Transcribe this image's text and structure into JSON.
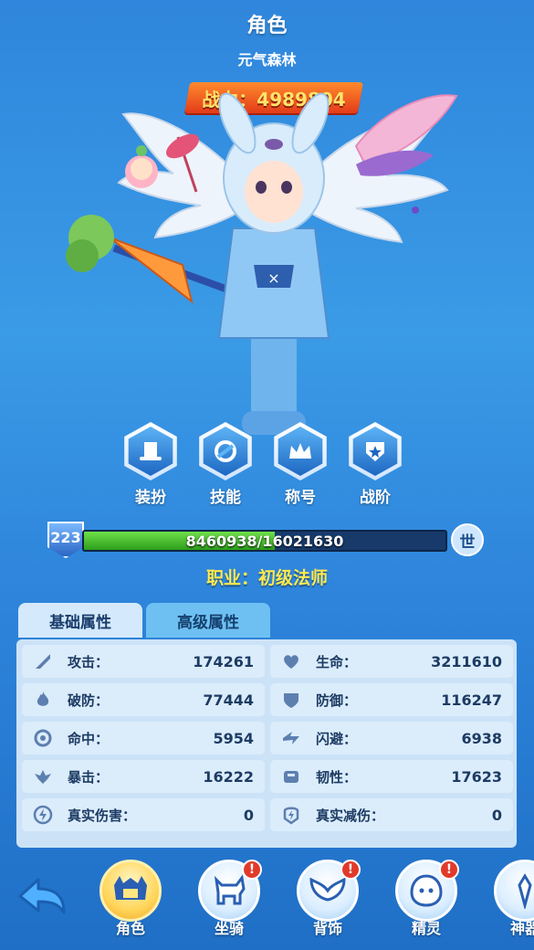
{
  "header": {
    "title": "角色",
    "subtitle": "元气森林",
    "power_label": "战力：4989804"
  },
  "actions": [
    {
      "label": "装扮",
      "icon": "top-hat-icon"
    },
    {
      "label": "技能",
      "icon": "skill-swirl-icon"
    },
    {
      "label": "称号",
      "icon": "crown-icon"
    },
    {
      "label": "战阶",
      "icon": "rank-shield-icon"
    }
  ],
  "level": {
    "value": "223",
    "xp_text": "8460938/16021630",
    "xp_fraction": 0.528,
    "world_button": "世"
  },
  "job": "职业：初级法师",
  "tabs": {
    "basic": "基础属性",
    "advanced": "高级属性"
  },
  "stats": [
    {
      "name": "攻击：",
      "value": "174261",
      "icon": "attack-icon"
    },
    {
      "name": "生命：",
      "value": "3211610",
      "icon": "heart-icon"
    },
    {
      "name": "破防：",
      "value": "77444",
      "icon": "flame-icon"
    },
    {
      "name": "防御：",
      "value": "116247",
      "icon": "shield-icon"
    },
    {
      "name": "命中：",
      "value": "5954",
      "icon": "target-icon"
    },
    {
      "name": "闪避：",
      "value": "6938",
      "icon": "dodge-icon"
    },
    {
      "name": "暴击：",
      "value": "16222",
      "icon": "crit-icon"
    },
    {
      "name": "韧性：",
      "value": "17623",
      "icon": "toughness-icon"
    },
    {
      "name": "真实伤害：",
      "value": "0",
      "icon": "true-damage-icon"
    },
    {
      "name": "真实减伤：",
      "value": "0",
      "icon": "true-reduction-icon"
    }
  ],
  "nav": [
    {
      "label": "角色",
      "icon": "character-helmet-icon",
      "active": true,
      "alert": false
    },
    {
      "label": "坐骑",
      "icon": "mount-icon",
      "active": false,
      "alert": true
    },
    {
      "label": "背饰",
      "icon": "wings-icon",
      "active": false,
      "alert": true
    },
    {
      "label": "精灵",
      "icon": "spirit-icon",
      "active": false,
      "alert": true
    },
    {
      "label": "神器",
      "icon": "artifact-icon",
      "active": false,
      "alert": false
    }
  ],
  "alert_mark": "!",
  "colors": {
    "background": "#2f86dc",
    "power_gold": "#ffe46a",
    "job_yellow": "#ffe94d",
    "xp_green": "#4fc634",
    "alert_red": "#e23a2a"
  }
}
